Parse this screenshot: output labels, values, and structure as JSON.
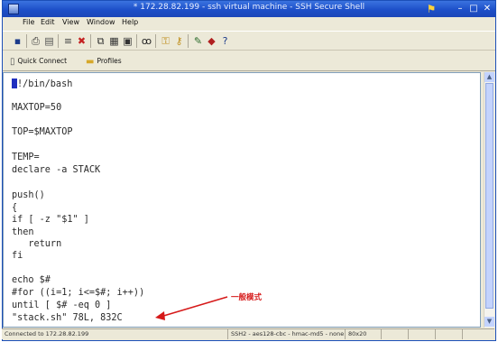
{
  "window": {
    "title": "* 172.28.82.199 - ssh virtual machine - SSH Secure Shell"
  },
  "menu": {
    "items": [
      "File",
      "Edit",
      "View",
      "Window",
      "Help"
    ]
  },
  "toolbar": {
    "icons": [
      "save-icon",
      "print-icon",
      "print-preview-icon",
      "find-icon",
      "disconnect-icon",
      "copy-icon",
      "paste-icon",
      "paste-alt-icon",
      "binoculars-icon",
      "key-icon",
      "key-alt-icon",
      "settings-icon",
      "plugin-icon",
      "help-icon"
    ]
  },
  "quickbar": {
    "quick_connect": "Quick Connect",
    "profiles": "Profiles"
  },
  "terminal": {
    "lines": [
      "#!/bin/bash",
      "",
      "MAXTOP=50",
      "",
      "TOP=$MAXTOP",
      "",
      "TEMP=",
      "declare -a STACK",
      "",
      "push()",
      "{",
      "if [ -z \"$1\" ]",
      "then",
      "   return",
      "fi",
      "",
      "echo $#",
      "#for ((i=1; i<=$#; i++))",
      "until [ $# -eq 0 ]",
      "\"stack.sh\" 78L, 832C"
    ]
  },
  "annotation": {
    "text": "一般模式",
    "color": "#d61919"
  },
  "statusbar": {
    "connection": "Connected to 172.28.82.199",
    "terminal_type": "SSH2 - aes128-cbc - hmac-md5 - none",
    "size": "80x20"
  },
  "colors": {
    "titlebar": "#1d4fc8",
    "cursor": "#1f2fbf",
    "terminal_bg": "#ffffff"
  }
}
